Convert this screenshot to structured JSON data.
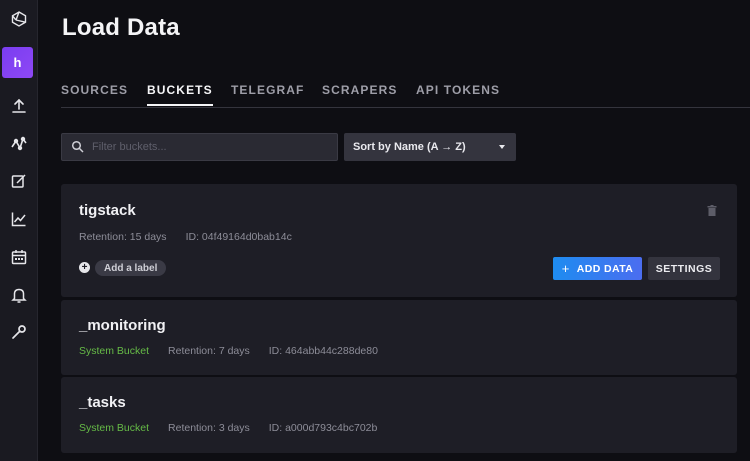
{
  "page": {
    "title": "Load Data"
  },
  "sidebar": {
    "org_initial": "h",
    "icons": [
      "logo-icon",
      "org-avatar",
      "upload-icon",
      "pulse-icon",
      "edit-icon",
      "chart-icon",
      "calendar-icon",
      "bell-icon",
      "wrench-icon"
    ]
  },
  "tabs": [
    {
      "label": "SOURCES",
      "active": false
    },
    {
      "label": "BUCKETS",
      "active": true
    },
    {
      "label": "TELEGRAF",
      "active": false
    },
    {
      "label": "SCRAPERS",
      "active": false
    },
    {
      "label": "API TOKENS",
      "active": false
    }
  ],
  "filter": {
    "placeholder": "Filter buckets...",
    "value": ""
  },
  "sort": {
    "label": "Sort by Name (A → Z)"
  },
  "buckets": [
    {
      "name": "tigstack",
      "system": "",
      "retention": "Retention: 15 days",
      "id": "ID: 04f49164d0bab14c",
      "add_label": "Add a label",
      "add_data": "ADD DATA",
      "settings": "SETTINGS"
    },
    {
      "name": "_monitoring",
      "system": "System Bucket",
      "retention": "Retention: 7 days",
      "id": "ID: 464abb44c288de80"
    },
    {
      "name": "_tasks",
      "system": "System Bucket",
      "retention": "Retention: 3 days",
      "id": "ID: a000d793c4bc702b"
    }
  ],
  "colors": {
    "accent_start": "#1e8cf0",
    "accent_end": "#4b6df0",
    "system_bucket": "#66bb47",
    "org_avatar": "#8e48f5"
  }
}
